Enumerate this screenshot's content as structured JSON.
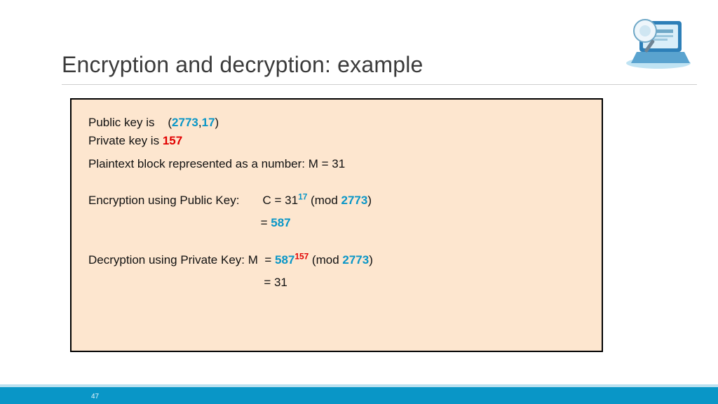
{
  "title": "Encryption and decryption: example",
  "page_number": "47",
  "keys": {
    "public_label": "Public key is    (",
    "public_n": "2773",
    "public_sep": ",",
    "public_e": "17",
    "public_close": ")",
    "private_label": "Private key is ",
    "private_d": "157"
  },
  "plaintext_line": "Plaintext block represented as a number: M = 31",
  "encryption": {
    "label": "Encryption using Public Key:       C = 31",
    "exp": "17",
    "mod_open": " (mod ",
    "mod_n": "2773",
    "mod_close": ")",
    "result_prefix": "                                                    = ",
    "result": "587"
  },
  "decryption": {
    "label": "Decryption using Private Key: M  = ",
    "base": "587",
    "exp": "157",
    "mod_open": " (mod ",
    "mod_n": "2773",
    "mod_close": ")",
    "result_line": "                                                     = 31"
  }
}
